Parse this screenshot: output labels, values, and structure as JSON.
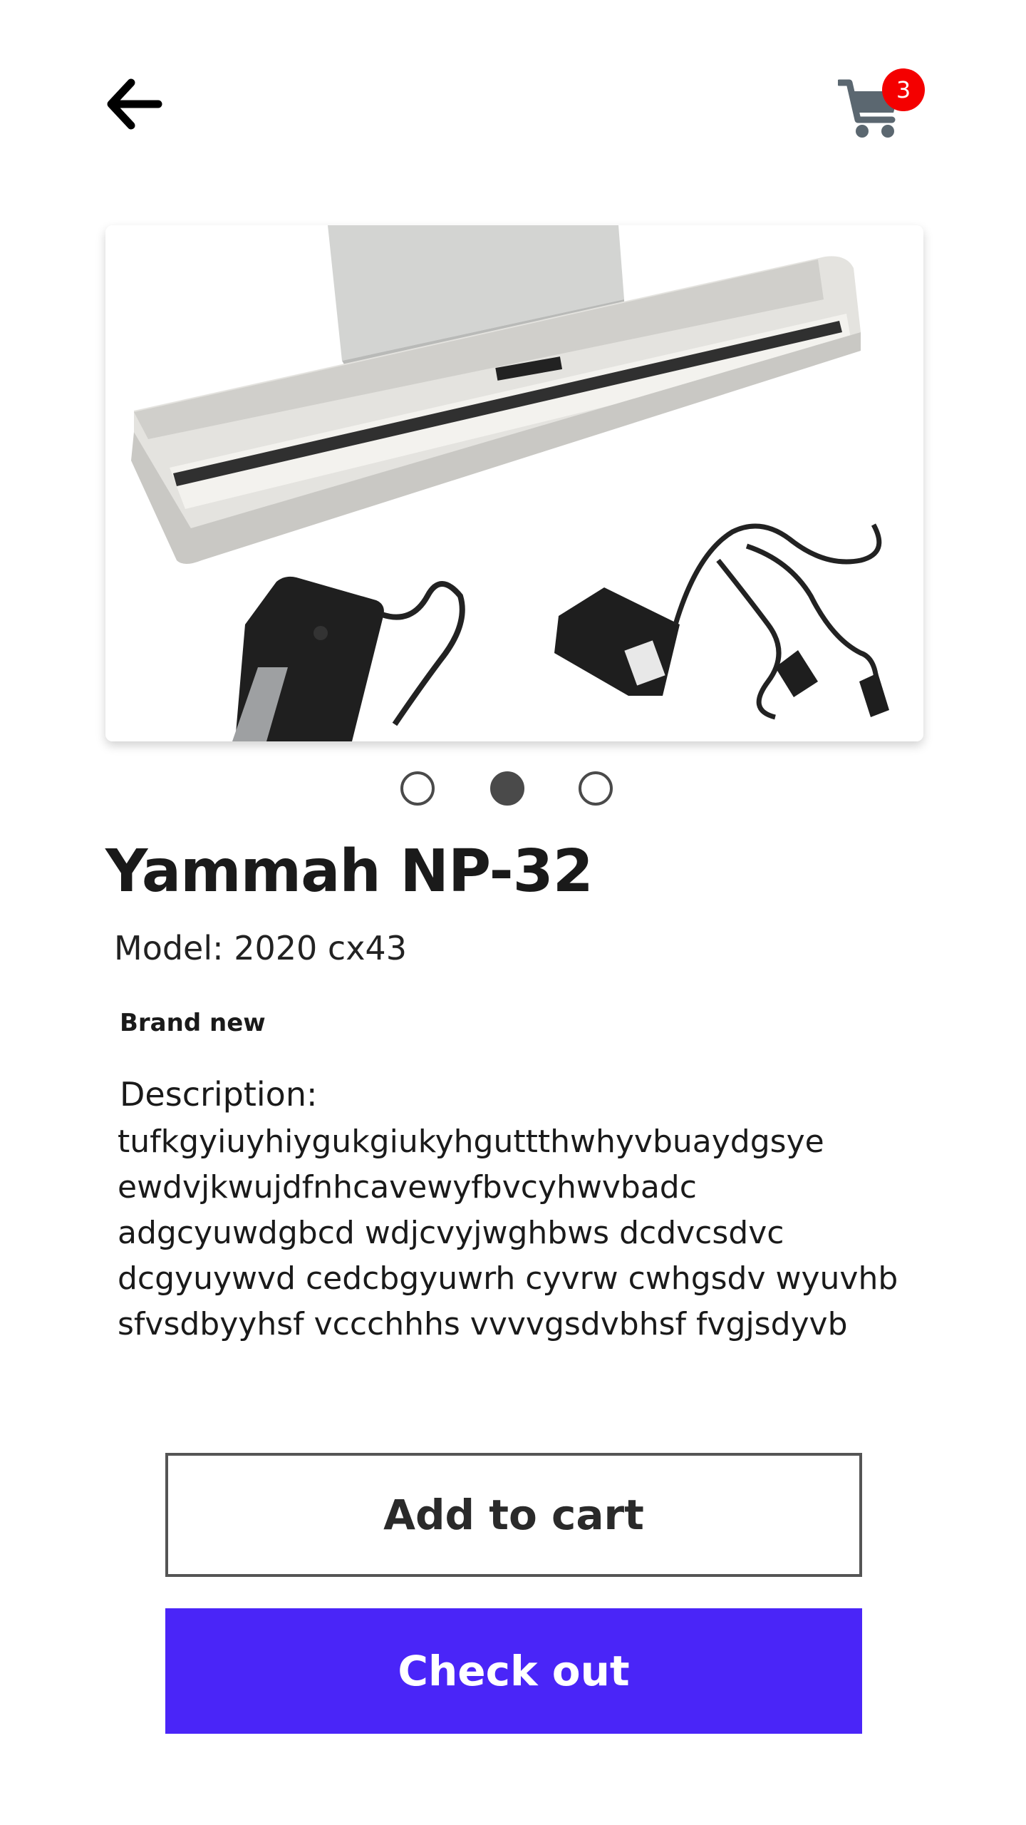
{
  "header": {
    "back_icon": "arrow-left-icon",
    "cart_icon": "shopping-cart-icon",
    "cart_count": "3",
    "badge_color": "#f40000"
  },
  "product": {
    "image_description_icon": "digital-piano-photo",
    "carousel": {
      "count": 3,
      "active_index": 1
    },
    "title": "Yammah NP-32",
    "model": "Model: 2020 cx43",
    "condition": "Brand new",
    "description_label": "Description:",
    "description": "tufkgyiuyhiygukgiukyhguttthwhyvbuaydgsye ewdvjkwujdfnhcavewyfbvcyhwvbadc adgcyuwdgbcd wdjcvyjwghbws dcdvcsdvc dcgyuywvd cedcbgyuwrh cyvrw cwhgsdv wyuvhb sfvsdbyyhsf vccchhhs vvvvgsdvbhsf fvgjsdyvb"
  },
  "actions": {
    "add_to_cart": "Add to cart",
    "check_out": "Check out",
    "accent_color": "#4a25f8"
  }
}
